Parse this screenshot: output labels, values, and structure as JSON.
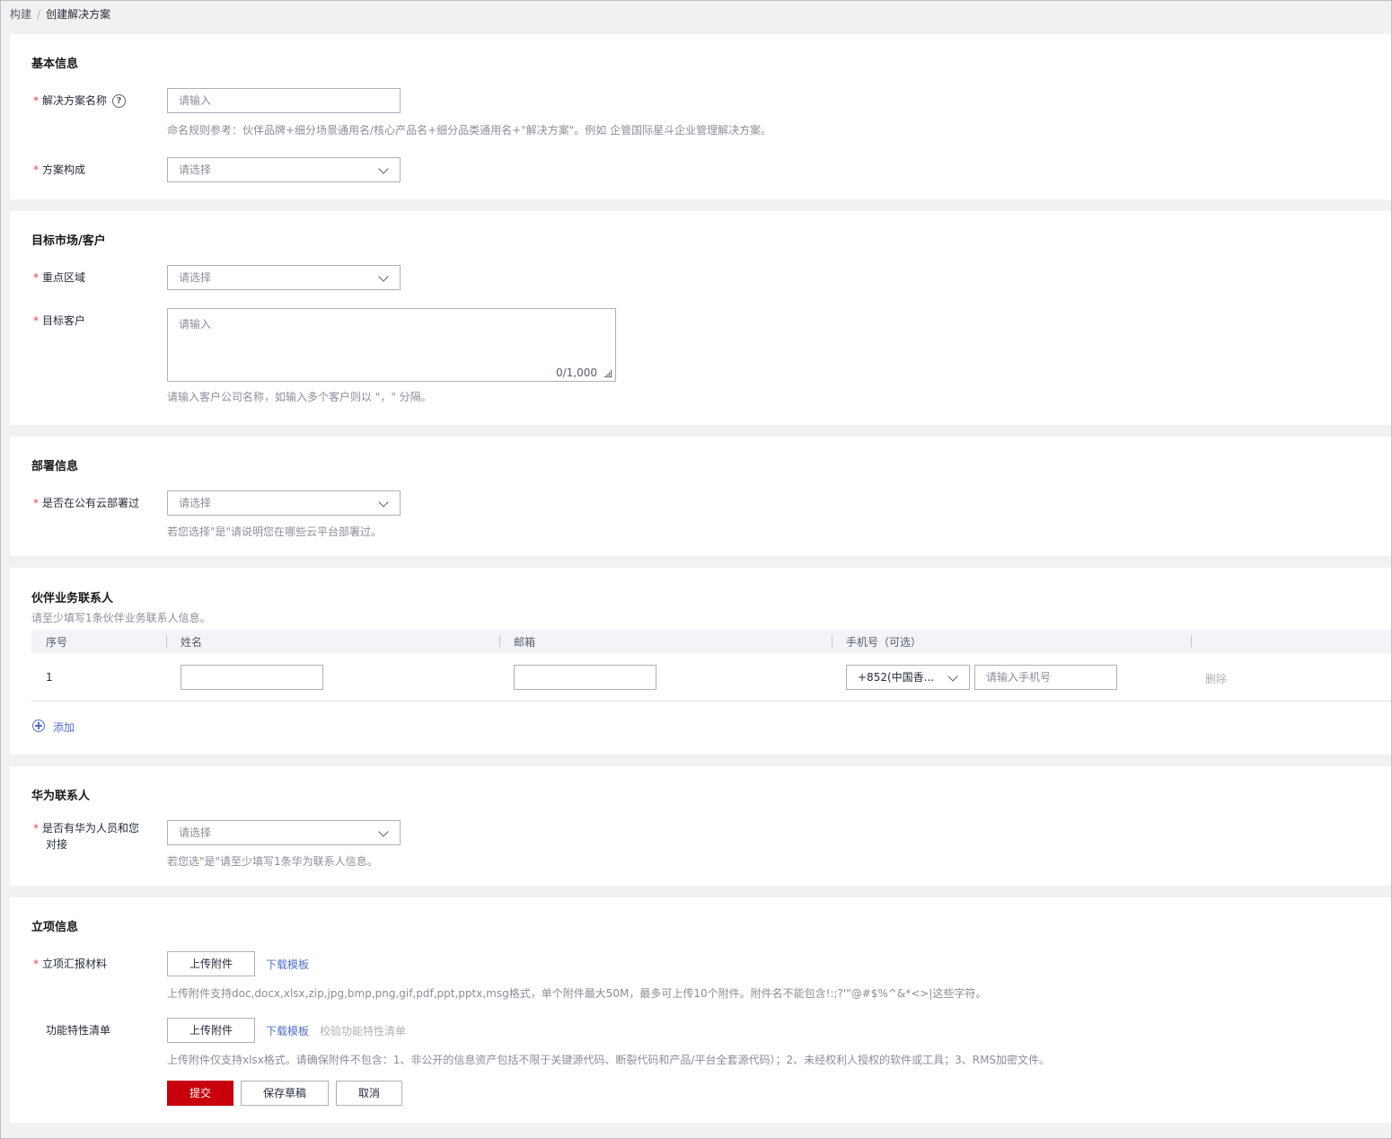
{
  "breadcrumb": {
    "root": "构建",
    "current": "创建解决方案"
  },
  "basic": {
    "title": "基本信息",
    "name_label": "解决方案名称",
    "name_placeholder": "请输入",
    "name_hint": "命名规则参考：伙伴品牌+细分场景通用名/核心产品名+细分品类通用名+\"解决方案\"。例如 企管国际星斗企业管理解决方案。",
    "composition_label": "方案构成",
    "composition_placeholder": "请选择"
  },
  "market": {
    "title": "目标市场/客户",
    "region_label": "重点区域",
    "region_placeholder": "请选择",
    "customer_label": "目标客户",
    "customer_placeholder": "请输入",
    "customer_counter": "0/1,000",
    "customer_hint": "请输入客户公司名称，如输入多个客户则以 \"，\" 分隔。"
  },
  "deploy": {
    "title": "部署信息",
    "cloud_label": "是否在公有云部署过",
    "cloud_placeholder": "请选择",
    "cloud_hint": "若您选择\"是\"请说明您在哪些云平台部署过。"
  },
  "partner_contacts": {
    "title": "伙伴业务联系人",
    "subtitle": "请至少填写1条伙伴业务联系人信息。",
    "columns": [
      "序号",
      "姓名",
      "邮箱",
      "手机号（可选）"
    ],
    "rows": [
      {
        "index": "1",
        "name": "",
        "email": "",
        "country_code": "+852(中国香...",
        "phone_placeholder": "请输入手机号",
        "delete_label": "删除"
      }
    ],
    "add_label": "添加"
  },
  "huawei_contacts": {
    "title": "华为联系人",
    "label_line1": "是否有华为人员和您",
    "label_line2": "对接",
    "placeholder": "请选择",
    "hint": "若您选\"是\"请至少填写1条华为联系人信息。"
  },
  "project": {
    "title": "立项信息",
    "report_label": "立项汇报材料",
    "upload_label": "上传附件",
    "download_template": "下载模板",
    "report_hint": "上传附件支持doc,docx,xlsx,zip,jpg,bmp,png,gif,pdf,ppt,pptx,msg格式，单个附件最大50M，最多可上传10个附件。附件名不能包含!:;?'\"@#$%^&*<>|这些字符。",
    "feature_label": "功能特性清单",
    "feature_upload_label": "上传附件",
    "feature_download_template": "下载模板",
    "feature_validate": "校验功能特性清单",
    "feature_hint": "上传附件仅支持xlsx格式。请确保附件不包含：1、非公开的信息资产包括不限于关键源代码、断裂代码和产品/平台全套源代码）；2、未经权利人授权的软件或工具；3、RMS加密文件。"
  },
  "actions": {
    "submit": "提交",
    "save_draft": "保存草稿",
    "cancel": "取消"
  },
  "colors": {
    "primary": "#c7000b",
    "link": "#526ecc",
    "required": "#e54545"
  }
}
